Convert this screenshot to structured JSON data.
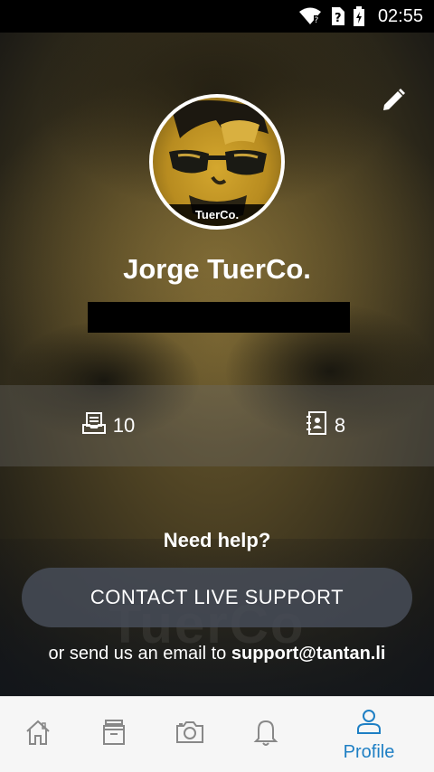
{
  "status_bar": {
    "time": "02:55"
  },
  "profile": {
    "avatar_tag": "TuerCo.",
    "name": "Jorge TuerCo.",
    "watermark": "TuerCo"
  },
  "stats": [
    {
      "icon": "inbox-tray-icon",
      "value": "10"
    },
    {
      "icon": "contacts-book-icon",
      "value": "8"
    }
  ],
  "help": {
    "title": "Need help?",
    "contact_button": "CONTACT LIVE SUPPORT",
    "email_prefix": "or send us an email to ",
    "email": "support@tantan.li"
  },
  "bottom_nav": {
    "items": [
      {
        "icon": "home-icon",
        "label": ""
      },
      {
        "icon": "archive-box-icon",
        "label": ""
      },
      {
        "icon": "camera-icon",
        "label": ""
      },
      {
        "icon": "bell-icon",
        "label": ""
      },
      {
        "icon": "person-icon",
        "label": "Profile",
        "active": true
      }
    ]
  },
  "colors": {
    "accent": "#1e7fc4",
    "nav_background": "#f6f6f6"
  }
}
